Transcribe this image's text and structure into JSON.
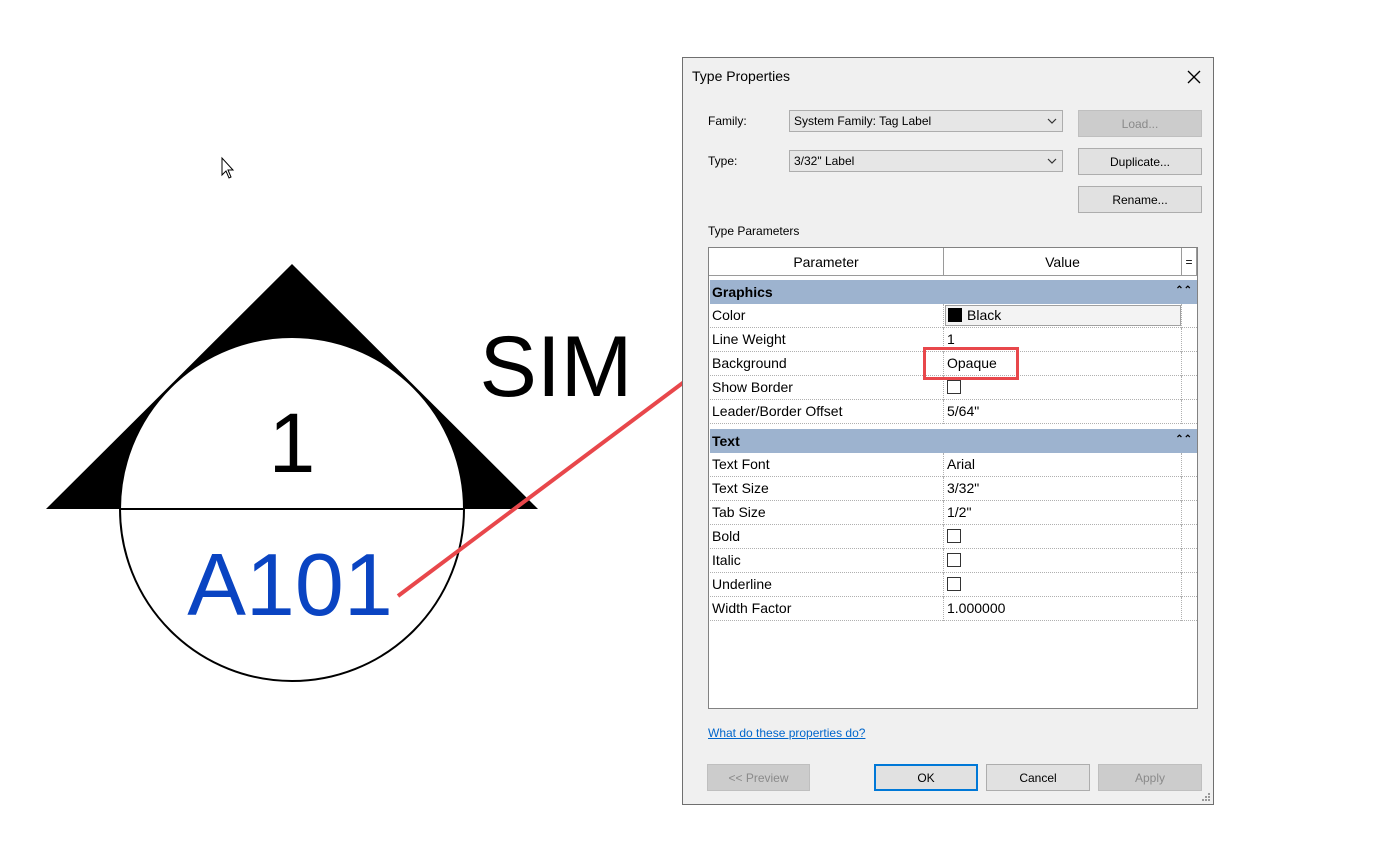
{
  "graphic": {
    "tag_number": "1",
    "sheet_number": "A101",
    "sim_label": "SIM",
    "sheet_number_color": "#0a44c2"
  },
  "dialog": {
    "title": "Type Properties",
    "family_label": "Family:",
    "family_value": "System Family: Tag Label",
    "type_label": "Type:",
    "type_value": "3/32\" Label",
    "load_label": "Load...",
    "duplicate_label": "Duplicate...",
    "rename_label": "Rename...",
    "type_parameters_label": "Type Parameters",
    "col_parameter": "Parameter",
    "col_value": "Value",
    "col_extra": "=",
    "groups": [
      {
        "name": "Graphics",
        "rows": [
          {
            "param": "Color",
            "value": "Black"
          },
          {
            "param": "Line Weight",
            "value": "1"
          },
          {
            "param": "Background",
            "value": "Opaque"
          },
          {
            "param": "Show Border",
            "value": "",
            "checkbox": true
          },
          {
            "param": "Leader/Border Offset",
            "value": "5/64\""
          }
        ]
      },
      {
        "name": "Text",
        "rows": [
          {
            "param": "Text Font",
            "value": "Arial"
          },
          {
            "param": "Text Size",
            "value": "3/32\""
          },
          {
            "param": "Tab Size",
            "value": "1/2\""
          },
          {
            "param": "Bold",
            "value": "",
            "checkbox": true
          },
          {
            "param": "Italic",
            "value": "",
            "checkbox": true
          },
          {
            "param": "Underline",
            "value": "",
            "checkbox": true
          },
          {
            "param": "Width Factor",
            "value": "1.000000"
          }
        ]
      }
    ],
    "help_link": "What do these properties do?",
    "preview_label": "<< Preview",
    "ok_label": "OK",
    "cancel_label": "Cancel",
    "apply_label": "Apply"
  },
  "annotation": {
    "highlight_color": "#e8474b",
    "arrow_color": "#e8474b"
  }
}
